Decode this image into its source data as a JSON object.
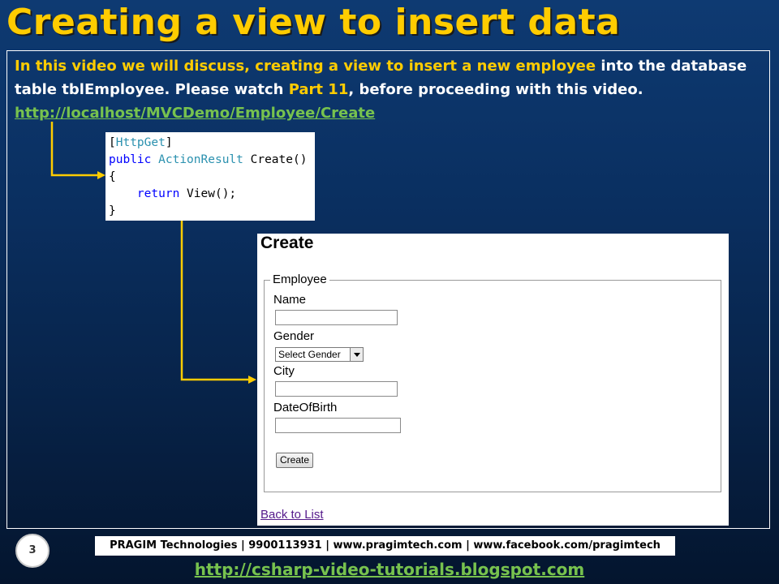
{
  "slide": {
    "title": "Creating a view to insert data",
    "intro": {
      "p1": "In this video we will discuss, creating a view to insert a new employee",
      "p2": " into the database table tblEmployee. Please watch ",
      "p3": "Part 11",
      "p4": ", before proceeding with this video.",
      "url": "http://localhost/MVCDemo/Employee/Create"
    },
    "code": {
      "attr": "HttpGet",
      "kw_public": "public",
      "type_name": "ActionResult",
      "method": " Create()",
      "open_brace": "{",
      "kw_return": "return",
      "return_rest": " View();",
      "close_brace": "}"
    },
    "page_number": "3",
    "footer": "PRAGIM Technologies | 9900113931 | www.pragimtech.com | www.facebook.com/pragimtech",
    "footer_link": "http://csharp-video-tutorials.blogspot.com",
    "colors": {
      "title": "#ffcc00",
      "link": "#77c24e",
      "arrow": "#ffcc00"
    }
  },
  "browser": {
    "heading": "Create",
    "legend": "Employee",
    "fields": {
      "name_label": "Name",
      "name_value": "",
      "gender_label": "Gender",
      "gender_selected": "Select Gender",
      "city_label": "City",
      "city_value": "",
      "dob_label": "DateOfBirth",
      "dob_value": ""
    },
    "submit_label": "Create",
    "back_link": "Back to List"
  }
}
